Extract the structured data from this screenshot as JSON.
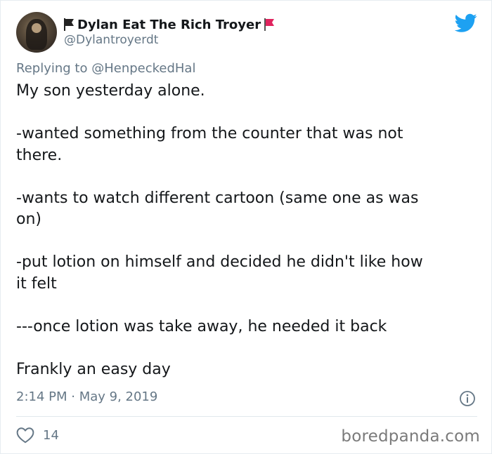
{
  "author": {
    "display_name": "Dylan Eat The Rich Troyer",
    "handle": "@Dylantroyerdt",
    "avatar_icon": "profile-photo",
    "prefix_flag_icon": "black-flag-icon",
    "suffix_flag_icon": "red-flag-icon"
  },
  "reply": {
    "prefix": "Replying to ",
    "mention": "@HenpeckedHal"
  },
  "tweet": {
    "paragraphs": [
      "My son yesterday alone.",
      "-wanted something from the counter that was not\nthere.",
      "-wants to watch different cartoon (same one as was\non)",
      "-put lotion on himself and decided he didn't like how\nit felt",
      "---once lotion was take away, he needed it back",
      "Frankly an easy day"
    ]
  },
  "meta": {
    "timestamp": "2:14 PM · May 9, 2019"
  },
  "engagement": {
    "likes": "14"
  },
  "watermark": "boredpanda.com",
  "colors": {
    "twitter_blue": "#1da1f2",
    "secondary_text": "#657786",
    "primary_text": "#14171a",
    "red_flag": "#e0245e"
  }
}
